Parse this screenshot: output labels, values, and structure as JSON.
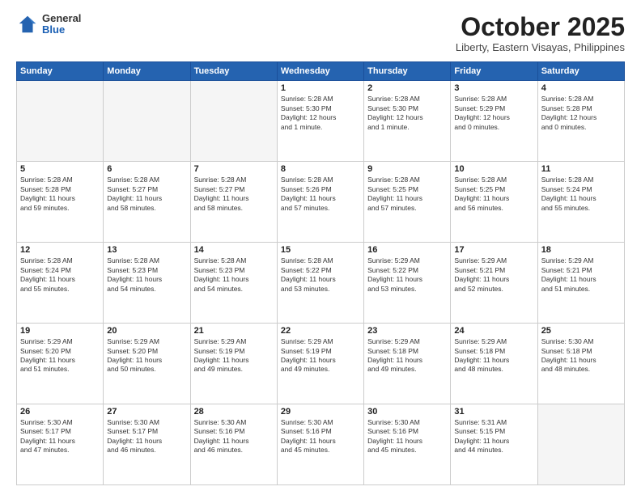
{
  "header": {
    "logo_general": "General",
    "logo_blue": "Blue",
    "month_title": "October 2025",
    "subtitle": "Liberty, Eastern Visayas, Philippines"
  },
  "days_of_week": [
    "Sunday",
    "Monday",
    "Tuesday",
    "Wednesday",
    "Thursday",
    "Friday",
    "Saturday"
  ],
  "weeks": [
    [
      {
        "day": "",
        "info": ""
      },
      {
        "day": "",
        "info": ""
      },
      {
        "day": "",
        "info": ""
      },
      {
        "day": "1",
        "info": "Sunrise: 5:28 AM\nSunset: 5:30 PM\nDaylight: 12 hours\nand 1 minute."
      },
      {
        "day": "2",
        "info": "Sunrise: 5:28 AM\nSunset: 5:30 PM\nDaylight: 12 hours\nand 1 minute."
      },
      {
        "day": "3",
        "info": "Sunrise: 5:28 AM\nSunset: 5:29 PM\nDaylight: 12 hours\nand 0 minutes."
      },
      {
        "day": "4",
        "info": "Sunrise: 5:28 AM\nSunset: 5:28 PM\nDaylight: 12 hours\nand 0 minutes."
      }
    ],
    [
      {
        "day": "5",
        "info": "Sunrise: 5:28 AM\nSunset: 5:28 PM\nDaylight: 11 hours\nand 59 minutes."
      },
      {
        "day": "6",
        "info": "Sunrise: 5:28 AM\nSunset: 5:27 PM\nDaylight: 11 hours\nand 58 minutes."
      },
      {
        "day": "7",
        "info": "Sunrise: 5:28 AM\nSunset: 5:27 PM\nDaylight: 11 hours\nand 58 minutes."
      },
      {
        "day": "8",
        "info": "Sunrise: 5:28 AM\nSunset: 5:26 PM\nDaylight: 11 hours\nand 57 minutes."
      },
      {
        "day": "9",
        "info": "Sunrise: 5:28 AM\nSunset: 5:25 PM\nDaylight: 11 hours\nand 57 minutes."
      },
      {
        "day": "10",
        "info": "Sunrise: 5:28 AM\nSunset: 5:25 PM\nDaylight: 11 hours\nand 56 minutes."
      },
      {
        "day": "11",
        "info": "Sunrise: 5:28 AM\nSunset: 5:24 PM\nDaylight: 11 hours\nand 55 minutes."
      }
    ],
    [
      {
        "day": "12",
        "info": "Sunrise: 5:28 AM\nSunset: 5:24 PM\nDaylight: 11 hours\nand 55 minutes."
      },
      {
        "day": "13",
        "info": "Sunrise: 5:28 AM\nSunset: 5:23 PM\nDaylight: 11 hours\nand 54 minutes."
      },
      {
        "day": "14",
        "info": "Sunrise: 5:28 AM\nSunset: 5:23 PM\nDaylight: 11 hours\nand 54 minutes."
      },
      {
        "day": "15",
        "info": "Sunrise: 5:28 AM\nSunset: 5:22 PM\nDaylight: 11 hours\nand 53 minutes."
      },
      {
        "day": "16",
        "info": "Sunrise: 5:29 AM\nSunset: 5:22 PM\nDaylight: 11 hours\nand 53 minutes."
      },
      {
        "day": "17",
        "info": "Sunrise: 5:29 AM\nSunset: 5:21 PM\nDaylight: 11 hours\nand 52 minutes."
      },
      {
        "day": "18",
        "info": "Sunrise: 5:29 AM\nSunset: 5:21 PM\nDaylight: 11 hours\nand 51 minutes."
      }
    ],
    [
      {
        "day": "19",
        "info": "Sunrise: 5:29 AM\nSunset: 5:20 PM\nDaylight: 11 hours\nand 51 minutes."
      },
      {
        "day": "20",
        "info": "Sunrise: 5:29 AM\nSunset: 5:20 PM\nDaylight: 11 hours\nand 50 minutes."
      },
      {
        "day": "21",
        "info": "Sunrise: 5:29 AM\nSunset: 5:19 PM\nDaylight: 11 hours\nand 49 minutes."
      },
      {
        "day": "22",
        "info": "Sunrise: 5:29 AM\nSunset: 5:19 PM\nDaylight: 11 hours\nand 49 minutes."
      },
      {
        "day": "23",
        "info": "Sunrise: 5:29 AM\nSunset: 5:18 PM\nDaylight: 11 hours\nand 49 minutes."
      },
      {
        "day": "24",
        "info": "Sunrise: 5:29 AM\nSunset: 5:18 PM\nDaylight: 11 hours\nand 48 minutes."
      },
      {
        "day": "25",
        "info": "Sunrise: 5:30 AM\nSunset: 5:18 PM\nDaylight: 11 hours\nand 48 minutes."
      }
    ],
    [
      {
        "day": "26",
        "info": "Sunrise: 5:30 AM\nSunset: 5:17 PM\nDaylight: 11 hours\nand 47 minutes."
      },
      {
        "day": "27",
        "info": "Sunrise: 5:30 AM\nSunset: 5:17 PM\nDaylight: 11 hours\nand 46 minutes."
      },
      {
        "day": "28",
        "info": "Sunrise: 5:30 AM\nSunset: 5:16 PM\nDaylight: 11 hours\nand 46 minutes."
      },
      {
        "day": "29",
        "info": "Sunrise: 5:30 AM\nSunset: 5:16 PM\nDaylight: 11 hours\nand 45 minutes."
      },
      {
        "day": "30",
        "info": "Sunrise: 5:30 AM\nSunset: 5:16 PM\nDaylight: 11 hours\nand 45 minutes."
      },
      {
        "day": "31",
        "info": "Sunrise: 5:31 AM\nSunset: 5:15 PM\nDaylight: 11 hours\nand 44 minutes."
      },
      {
        "day": "",
        "info": ""
      }
    ]
  ]
}
